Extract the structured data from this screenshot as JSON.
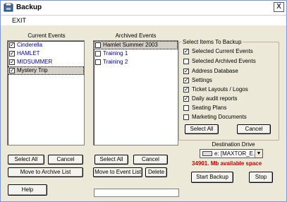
{
  "window": {
    "title": "Backup",
    "close_glyph": "X",
    "icon": "backup-app-icon"
  },
  "menu": {
    "exit": "EXIT"
  },
  "current_events": {
    "label": "Current Events",
    "items": [
      {
        "name": "Cinderella",
        "checked": true
      },
      {
        "name": "HAMLET",
        "checked": true
      },
      {
        "name": "MIDSUMMER",
        "checked": true
      },
      {
        "name": "Mystery Trip",
        "checked": true,
        "selected": true
      }
    ],
    "select_all": "Select All",
    "cancel": "Cancel",
    "move": "Move to Archive List"
  },
  "archived_events": {
    "label": "Archived Events",
    "items": [
      {
        "name": "Hamlet Summer 2003",
        "checked": false,
        "selected": true
      },
      {
        "name": "Training 1",
        "checked": false
      },
      {
        "name": "Training 2",
        "checked": false
      }
    ],
    "select_all": "Select All",
    "cancel": "Cancel",
    "move": "Move to Event List",
    "delete": "Delete"
  },
  "backup_items": {
    "title": "Select Items To Backup",
    "options": [
      {
        "label": "Selected Current Events",
        "checked": true
      },
      {
        "label": "Selected Archived Events",
        "checked": false
      },
      {
        "label": "Address Database",
        "checked": true
      },
      {
        "label": "Settings",
        "checked": true
      },
      {
        "label": "Ticket Layouts / Logos",
        "checked": true
      },
      {
        "label": "Daily audit reports",
        "checked": true
      },
      {
        "label": "Seating Plans",
        "checked": false
      },
      {
        "label": "Marketing Documents",
        "checked": false
      }
    ],
    "select_all": "Select All",
    "cancel": "Cancel"
  },
  "destination": {
    "label": "Destination Drive",
    "drive": "e: [MAXTOR_E...]",
    "space": "34901. Mb  available space"
  },
  "actions": {
    "help": "Help",
    "start_backup": "Start Backup",
    "stop": "Stop"
  },
  "colors": {
    "list_text": "#0000a0",
    "space_text": "#cc0000",
    "window_bg": "#ece9d8"
  }
}
